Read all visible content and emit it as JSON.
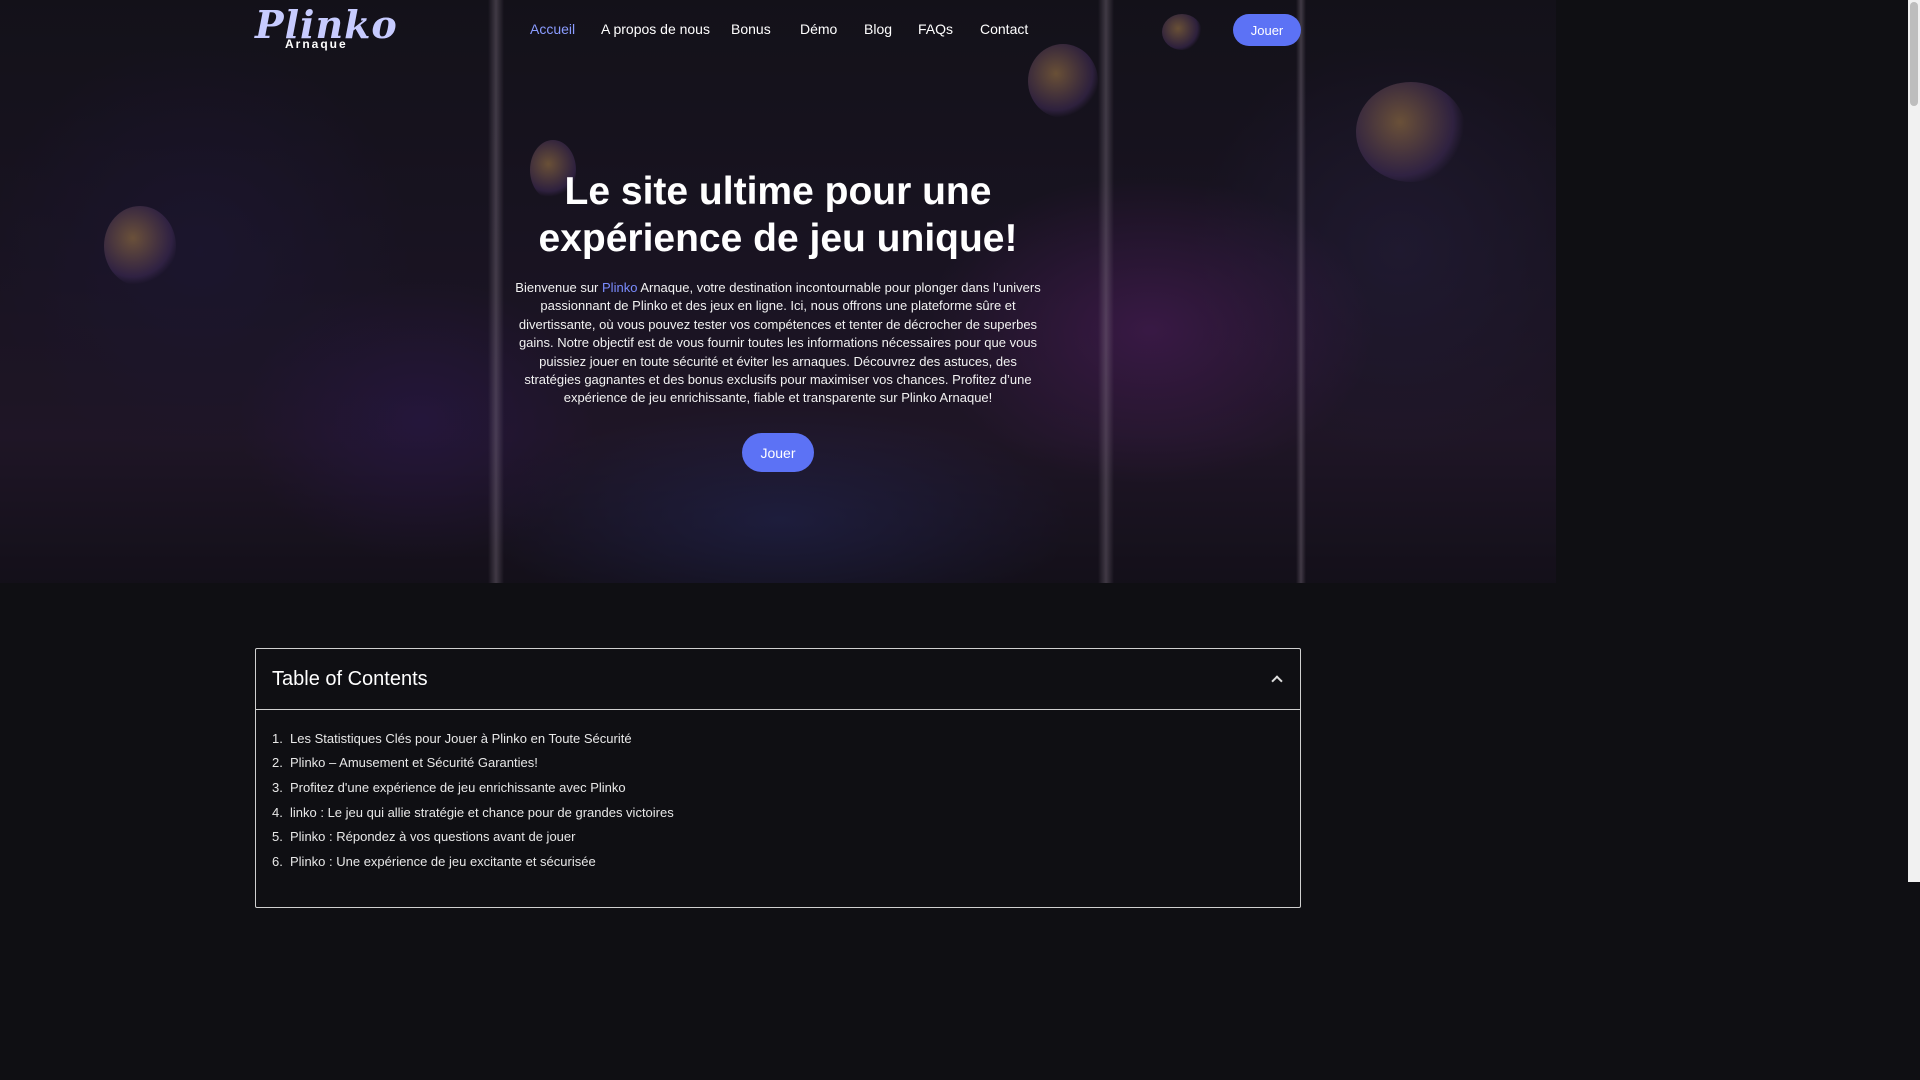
{
  "header": {
    "logo_main": "Plinko",
    "logo_sub": "Arnaque",
    "nav": [
      {
        "label": "Accueil",
        "active": true
      },
      {
        "label": "A propos de nous",
        "active": false
      },
      {
        "label": "Bonus",
        "active": false
      },
      {
        "label": "Démo",
        "active": false
      },
      {
        "label": "Blog",
        "active": false
      },
      {
        "label": "FAQs",
        "active": false
      },
      {
        "label": "Contact",
        "active": false
      }
    ],
    "cta_label": "Jouer"
  },
  "hero": {
    "title": "Le site ultime pour une expérience de jeu unique!",
    "text_before": "Bienvenue sur ",
    "text_accent": "Plinko",
    "text_after": " Arnaque, votre destination incontournable pour plonger dans l’univers passionnant de Plinko et des jeux en ligne. Ici, nous offrons une plateforme sûre et divertissante, où vous pouvez tester vos compétences et tenter de décrocher de superbes gains. Notre objectif est de vous fournir toutes les informations nécessaires pour que vous puissiez jouer en toute sécurité et éviter les arnaques. Découvrez des astuces, des stratégies gagnantes et des bonus exclusifs pour maximiser vos chances. Profitez d’une expérience de jeu enrichissante, fiable et transparente sur Plinko Arnaque!",
    "cta_label": "Jouer"
  },
  "toc": {
    "title": "Table of Contents",
    "items": [
      {
        "num": "1.",
        "label": "Les Statistiques Clés pour Jouer à Plinko en Toute Sécurité"
      },
      {
        "num": "2.",
        "label": "Plinko – Amusement et Sécurité Garanties!"
      },
      {
        "num": "3.",
        "label": "Profitez d'une expérience de jeu enrichissante avec Plinko"
      },
      {
        "num": "4.",
        "label": "linko : Le jeu qui allie stratégie et chance pour de grandes victoires"
      },
      {
        "num": "5.",
        "label": "Plinko : Répondez à vos questions avant de jouer"
      },
      {
        "num": "6.",
        "label": "Plinko : Une expérience de jeu excitante et sécurisée"
      }
    ]
  },
  "colors": {
    "accent": "#5c72f5",
    "nav_active": "#8a9cff",
    "background": "#0f0f13"
  }
}
